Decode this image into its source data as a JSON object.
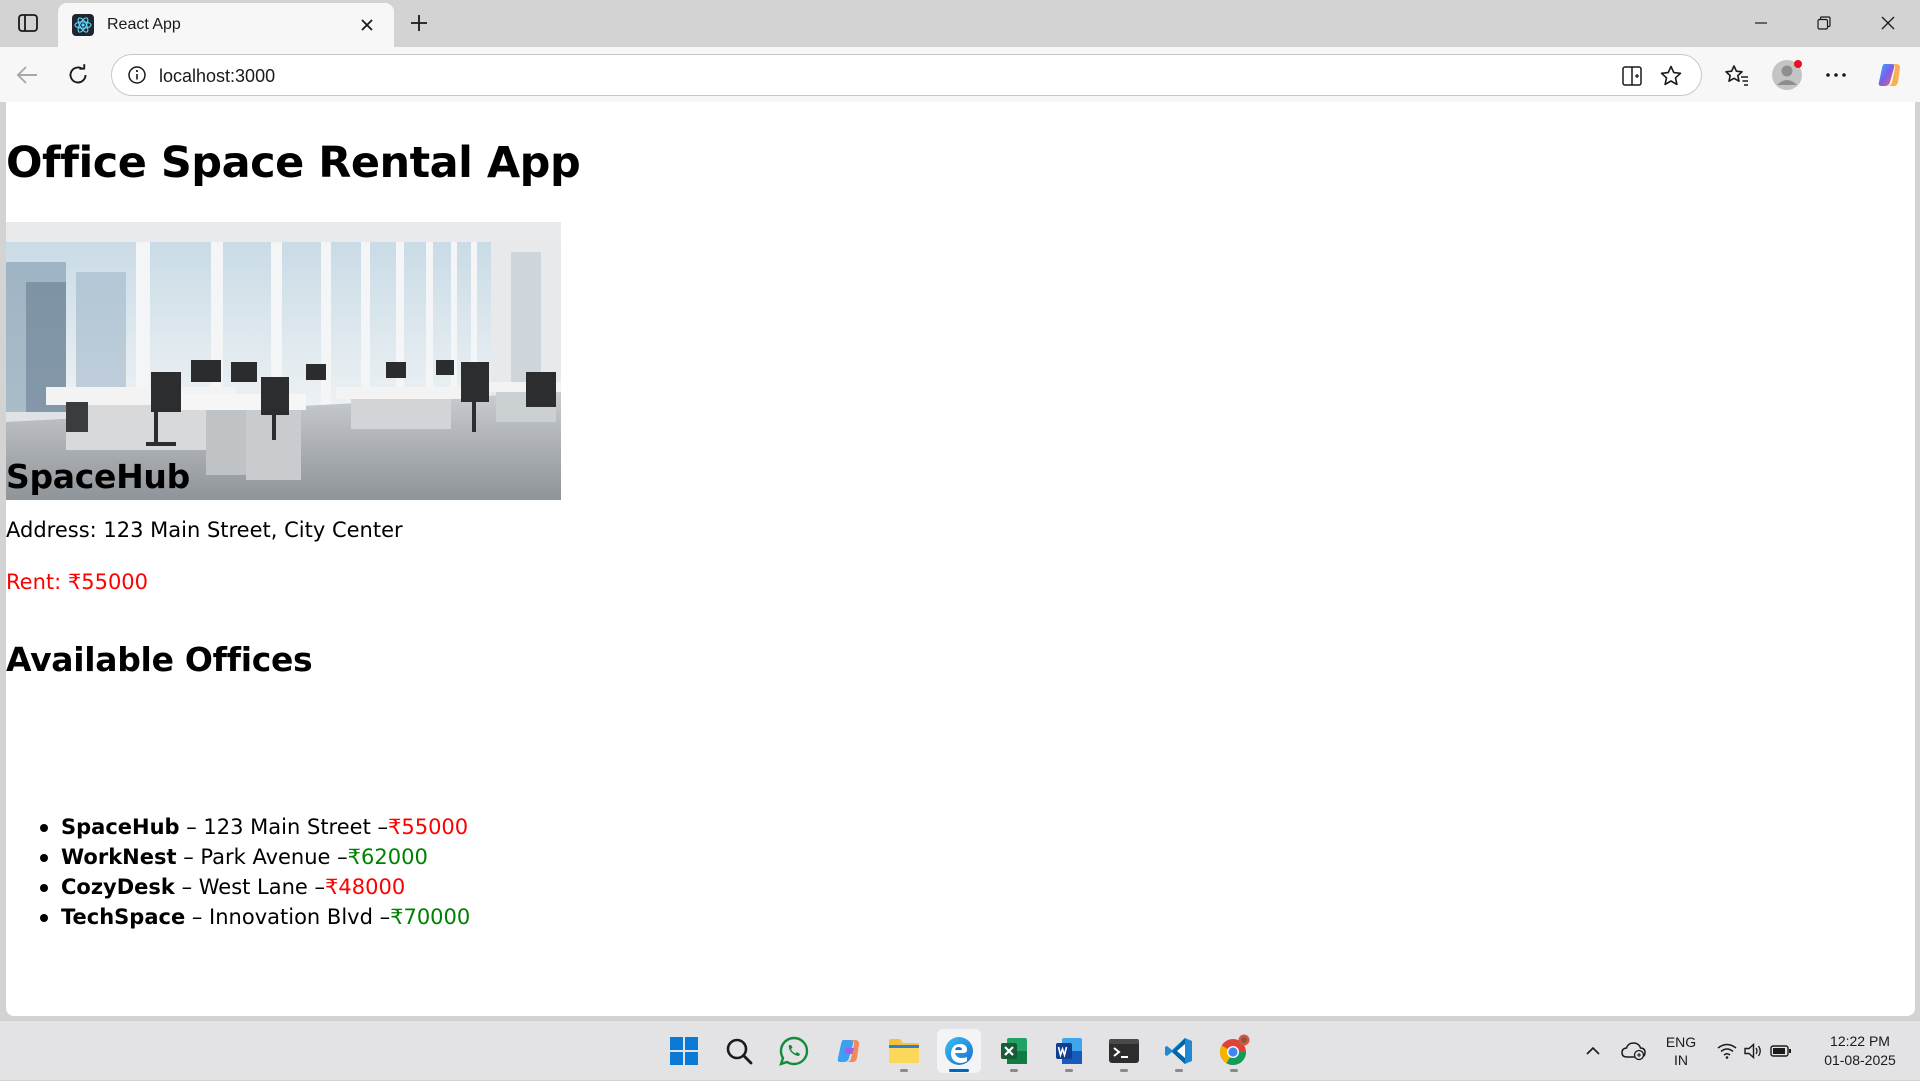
{
  "browser": {
    "tab": {
      "title": "React App",
      "favicon": "react-logo-icon"
    },
    "address": "localhost:3000",
    "icons": {
      "tab_actions": "tab-actions-icon",
      "close_tab": "close-icon",
      "new_tab": "plus-icon",
      "back": "arrow-left-icon",
      "refresh": "refresh-icon",
      "site_info": "info-icon",
      "split_screen": "split-screen-icon",
      "favorite": "star-icon",
      "favorites": "favorites-icon",
      "profile": "profile-avatar-icon",
      "more": "more-icon",
      "copilot": "copilot-icon",
      "minimize": "minimize-icon",
      "restore": "restore-icon",
      "close_window": "close-window-icon"
    }
  },
  "page": {
    "title": "Office Space Rental App",
    "image_icon": "office-photo",
    "featured": {
      "name": "SpaceHub",
      "address": "Address: 123 Main Street, City Center",
      "rent": "Rent: ₹55000"
    },
    "list_title": "Available Offices",
    "offices": [
      {
        "name": "SpaceHub",
        "sep": " – 123 Main Street –",
        "price": "₹55000",
        "price_color": "#ff0000"
      },
      {
        "name": "WorkNest",
        "sep": " – Park Avenue –",
        "price": "₹62000",
        "price_color": "#008000"
      },
      {
        "name": "CozyDesk",
        "sep": " – West Lane –",
        "price": "₹48000",
        "price_color": "#ff0000"
      },
      {
        "name": "TechSpace",
        "sep": " – Innovation Blvd –",
        "price": "₹70000",
        "price_color": "#008000"
      }
    ]
  },
  "taskbar": {
    "apps": [
      "windows-start-icon",
      "search-icon",
      "whatsapp-icon",
      "copilot-icon",
      "file-explorer-icon",
      "edge-icon",
      "excel-icon",
      "word-icon",
      "terminal-icon",
      "vscode-icon",
      "chrome-icon"
    ],
    "tray": {
      "language_line1": "ENG",
      "language_line2": "IN",
      "time": "12:22 PM",
      "date": "01-08-2025"
    }
  }
}
